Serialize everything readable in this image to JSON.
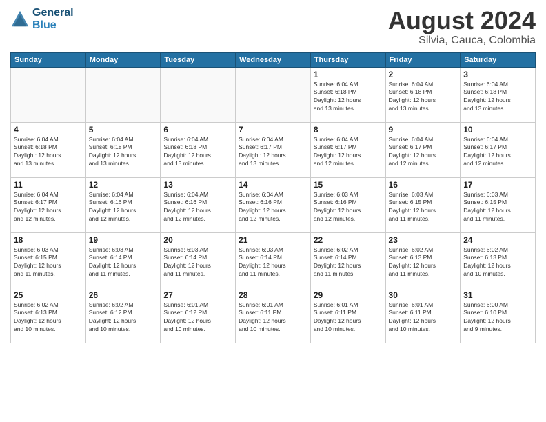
{
  "header": {
    "logo_line1": "General",
    "logo_line2": "Blue",
    "month": "August 2024",
    "location": "Silvia, Cauca, Colombia"
  },
  "weekdays": [
    "Sunday",
    "Monday",
    "Tuesday",
    "Wednesday",
    "Thursday",
    "Friday",
    "Saturday"
  ],
  "weeks": [
    [
      {
        "day": "",
        "info": "",
        "empty": true
      },
      {
        "day": "",
        "info": "",
        "empty": true
      },
      {
        "day": "",
        "info": "",
        "empty": true
      },
      {
        "day": "",
        "info": "",
        "empty": true
      },
      {
        "day": "1",
        "info": "Sunrise: 6:04 AM\nSunset: 6:18 PM\nDaylight: 12 hours\nand 13 minutes."
      },
      {
        "day": "2",
        "info": "Sunrise: 6:04 AM\nSunset: 6:18 PM\nDaylight: 12 hours\nand 13 minutes."
      },
      {
        "day": "3",
        "info": "Sunrise: 6:04 AM\nSunset: 6:18 PM\nDaylight: 12 hours\nand 13 minutes."
      }
    ],
    [
      {
        "day": "4",
        "info": "Sunrise: 6:04 AM\nSunset: 6:18 PM\nDaylight: 12 hours\nand 13 minutes."
      },
      {
        "day": "5",
        "info": "Sunrise: 6:04 AM\nSunset: 6:18 PM\nDaylight: 12 hours\nand 13 minutes."
      },
      {
        "day": "6",
        "info": "Sunrise: 6:04 AM\nSunset: 6:18 PM\nDaylight: 12 hours\nand 13 minutes."
      },
      {
        "day": "7",
        "info": "Sunrise: 6:04 AM\nSunset: 6:17 PM\nDaylight: 12 hours\nand 13 minutes."
      },
      {
        "day": "8",
        "info": "Sunrise: 6:04 AM\nSunset: 6:17 PM\nDaylight: 12 hours\nand 12 minutes."
      },
      {
        "day": "9",
        "info": "Sunrise: 6:04 AM\nSunset: 6:17 PM\nDaylight: 12 hours\nand 12 minutes."
      },
      {
        "day": "10",
        "info": "Sunrise: 6:04 AM\nSunset: 6:17 PM\nDaylight: 12 hours\nand 12 minutes."
      }
    ],
    [
      {
        "day": "11",
        "info": "Sunrise: 6:04 AM\nSunset: 6:17 PM\nDaylight: 12 hours\nand 12 minutes."
      },
      {
        "day": "12",
        "info": "Sunrise: 6:04 AM\nSunset: 6:16 PM\nDaylight: 12 hours\nand 12 minutes."
      },
      {
        "day": "13",
        "info": "Sunrise: 6:04 AM\nSunset: 6:16 PM\nDaylight: 12 hours\nand 12 minutes."
      },
      {
        "day": "14",
        "info": "Sunrise: 6:04 AM\nSunset: 6:16 PM\nDaylight: 12 hours\nand 12 minutes."
      },
      {
        "day": "15",
        "info": "Sunrise: 6:03 AM\nSunset: 6:16 PM\nDaylight: 12 hours\nand 12 minutes."
      },
      {
        "day": "16",
        "info": "Sunrise: 6:03 AM\nSunset: 6:15 PM\nDaylight: 12 hours\nand 11 minutes."
      },
      {
        "day": "17",
        "info": "Sunrise: 6:03 AM\nSunset: 6:15 PM\nDaylight: 12 hours\nand 11 minutes."
      }
    ],
    [
      {
        "day": "18",
        "info": "Sunrise: 6:03 AM\nSunset: 6:15 PM\nDaylight: 12 hours\nand 11 minutes."
      },
      {
        "day": "19",
        "info": "Sunrise: 6:03 AM\nSunset: 6:14 PM\nDaylight: 12 hours\nand 11 minutes."
      },
      {
        "day": "20",
        "info": "Sunrise: 6:03 AM\nSunset: 6:14 PM\nDaylight: 12 hours\nand 11 minutes."
      },
      {
        "day": "21",
        "info": "Sunrise: 6:03 AM\nSunset: 6:14 PM\nDaylight: 12 hours\nand 11 minutes."
      },
      {
        "day": "22",
        "info": "Sunrise: 6:02 AM\nSunset: 6:14 PM\nDaylight: 12 hours\nand 11 minutes."
      },
      {
        "day": "23",
        "info": "Sunrise: 6:02 AM\nSunset: 6:13 PM\nDaylight: 12 hours\nand 11 minutes."
      },
      {
        "day": "24",
        "info": "Sunrise: 6:02 AM\nSunset: 6:13 PM\nDaylight: 12 hours\nand 10 minutes."
      }
    ],
    [
      {
        "day": "25",
        "info": "Sunrise: 6:02 AM\nSunset: 6:13 PM\nDaylight: 12 hours\nand 10 minutes."
      },
      {
        "day": "26",
        "info": "Sunrise: 6:02 AM\nSunset: 6:12 PM\nDaylight: 12 hours\nand 10 minutes."
      },
      {
        "day": "27",
        "info": "Sunrise: 6:01 AM\nSunset: 6:12 PM\nDaylight: 12 hours\nand 10 minutes."
      },
      {
        "day": "28",
        "info": "Sunrise: 6:01 AM\nSunset: 6:11 PM\nDaylight: 12 hours\nand 10 minutes."
      },
      {
        "day": "29",
        "info": "Sunrise: 6:01 AM\nSunset: 6:11 PM\nDaylight: 12 hours\nand 10 minutes."
      },
      {
        "day": "30",
        "info": "Sunrise: 6:01 AM\nSunset: 6:11 PM\nDaylight: 12 hours\nand 10 minutes."
      },
      {
        "day": "31",
        "info": "Sunrise: 6:00 AM\nSunset: 6:10 PM\nDaylight: 12 hours\nand 9 minutes."
      }
    ]
  ]
}
